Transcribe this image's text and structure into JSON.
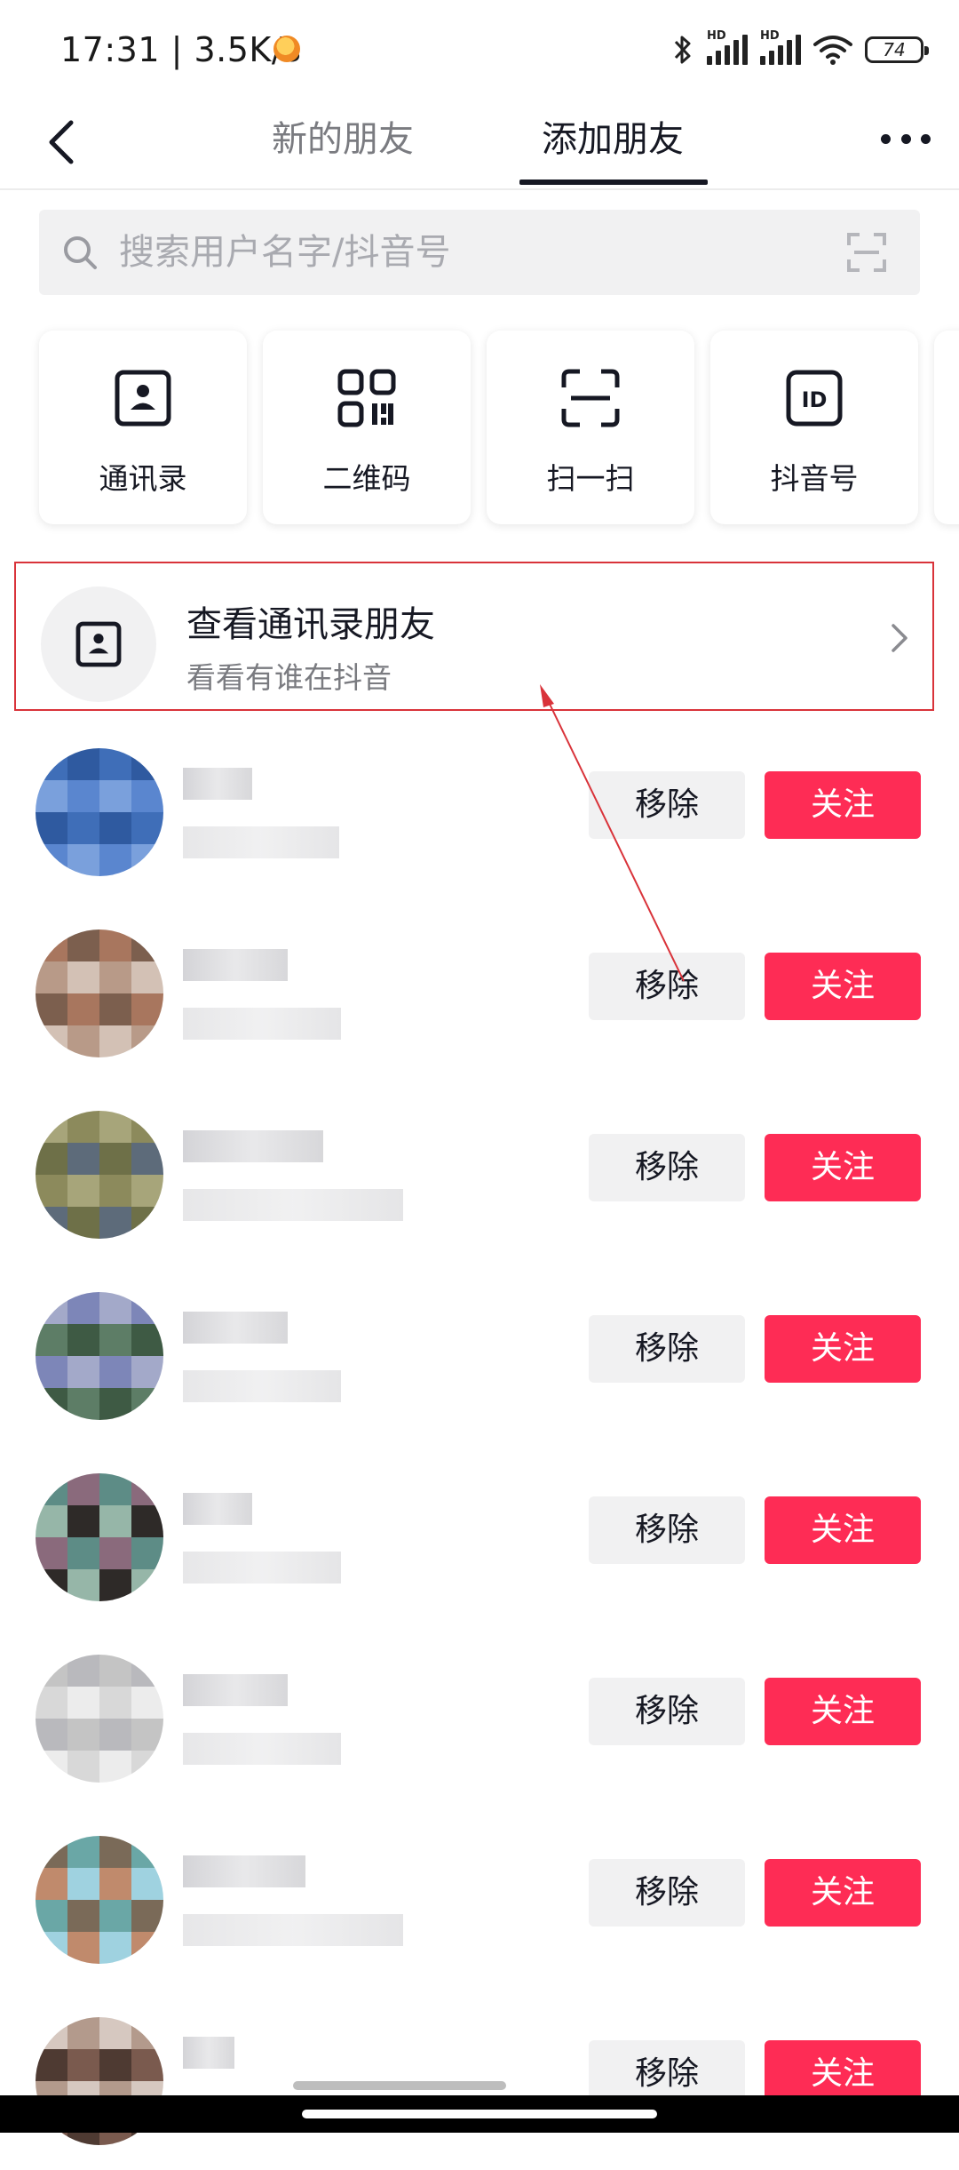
{
  "status_bar": {
    "time": "17:31 | 3.5K/s",
    "battery": "74",
    "hd_label": "HD"
  },
  "nav": {
    "tabs": [
      {
        "label": "新的朋友"
      },
      {
        "label": "添加朋友"
      }
    ],
    "active_tab": 1
  },
  "search": {
    "placeholder": "搜索用户名字/抖音号"
  },
  "quick_actions": [
    {
      "label": "通讯录",
      "icon": "contact-book-icon"
    },
    {
      "label": "二维码",
      "icon": "qr-code-icon"
    },
    {
      "label": "扫一扫",
      "icon": "scan-icon"
    },
    {
      "label": "抖音号",
      "icon": "id-icon"
    }
  ],
  "contacts_banner": {
    "title": "查看通讯录朋友",
    "subtitle": "看看有谁在抖音"
  },
  "friends": {
    "remove_label": "移除",
    "follow_label": "关注",
    "items": [
      {
        "palette": [
          "#3f6eb8",
          "#5a86cf",
          "#2f5aa0",
          "#7aa0dc"
        ]
      },
      {
        "palette": [
          "#b89a88",
          "#a8765e",
          "#d3c1b5",
          "#7c5f4e"
        ]
      },
      {
        "palette": [
          "#8c8a5c",
          "#6e7048",
          "#a7a57a",
          "#5d6b7a"
        ]
      },
      {
        "palette": [
          "#3e5a44",
          "#7d86b8",
          "#5d7d66",
          "#a3a9c9"
        ]
      },
      {
        "palette": [
          "#5d8c86",
          "#2e2a28",
          "#8a6a7c",
          "#96b6a8"
        ]
      },
      {
        "palette": [
          "#d8d8d8",
          "#c4c4c4",
          "#ececec",
          "#b9b9bd"
        ]
      },
      {
        "palette": [
          "#6aa7a6",
          "#c08a6c",
          "#7a6a58",
          "#9fd2e0"
        ]
      },
      {
        "palette": [
          "#7a5a4e",
          "#b39a8c",
          "#4e3a32",
          "#d6c8c0"
        ]
      }
    ]
  },
  "colors": {
    "accent": "#fe2c55",
    "annotation": "#d9333a"
  }
}
